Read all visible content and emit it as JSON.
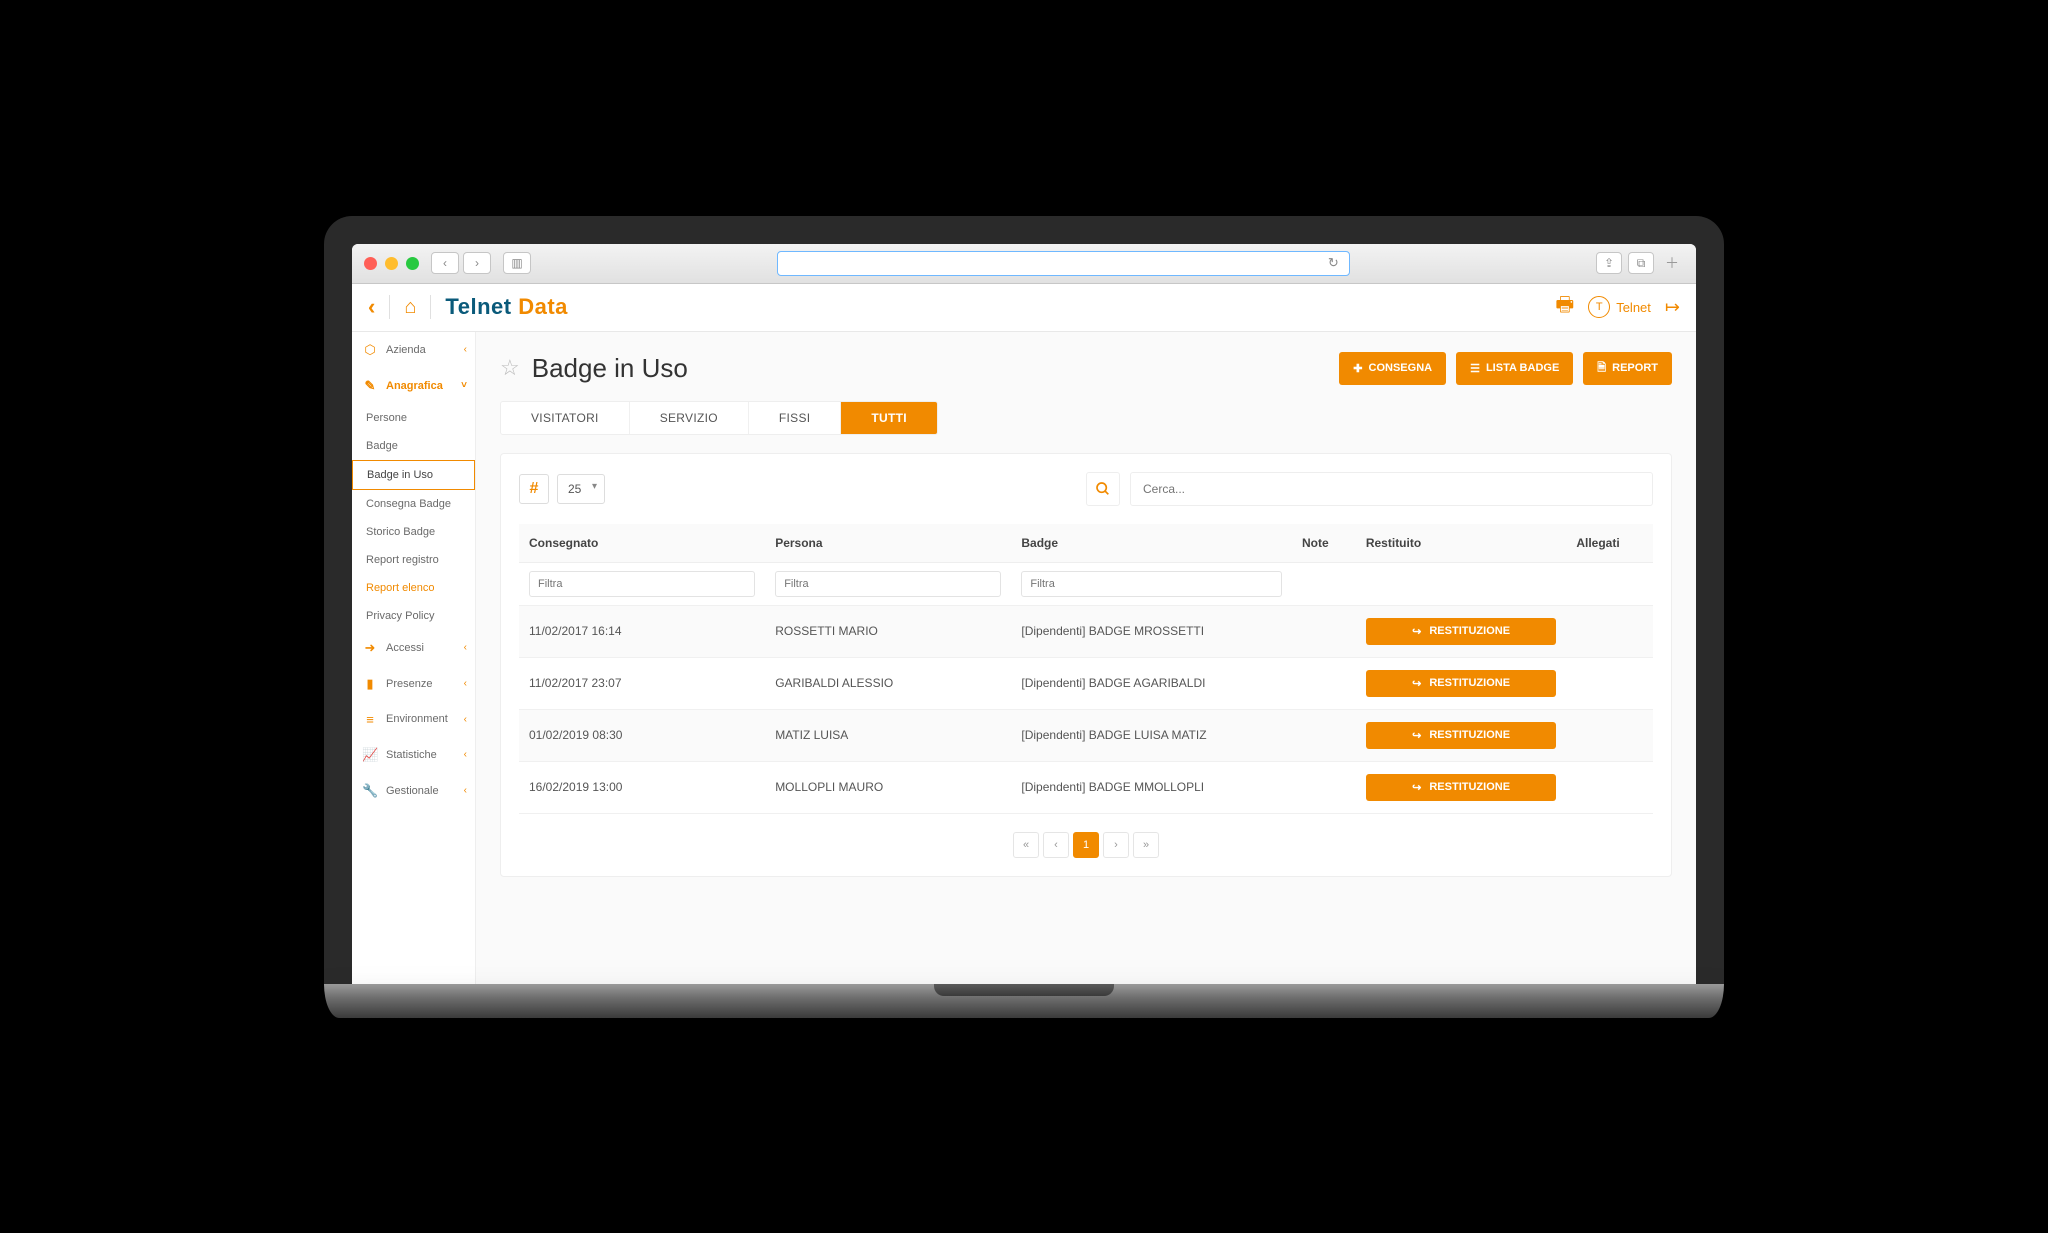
{
  "logo": {
    "part1": "Telnet",
    "part2": "Data"
  },
  "header": {
    "user_label": "Telnet",
    "user_initial": "T"
  },
  "sidebar": {
    "sections": [
      {
        "icon": "⬡",
        "label": "Azienda",
        "chev": "‹"
      },
      {
        "icon": "✎",
        "label": "Anagrafica",
        "chev": "˅",
        "active": true
      }
    ],
    "subs": [
      {
        "label": "Persone"
      },
      {
        "label": "Badge"
      },
      {
        "label": "Badge in Uso",
        "current": true
      },
      {
        "label": "Consegna Badge"
      },
      {
        "label": "Storico Badge"
      },
      {
        "label": "Report registro"
      },
      {
        "label": "Report elenco",
        "orange": true
      },
      {
        "label": "Privacy Policy"
      }
    ],
    "bottom": [
      {
        "icon": "➜",
        "label": "Accessi"
      },
      {
        "icon": "▮",
        "label": "Presenze"
      },
      {
        "icon": "≡",
        "label": "Environment"
      },
      {
        "icon": "📈",
        "label": "Statistiche"
      },
      {
        "icon": "🔧",
        "label": "Gestionale"
      }
    ]
  },
  "page": {
    "title": "Badge in Uso",
    "actions": [
      {
        "icon": "✚",
        "label": "CONSEGNA"
      },
      {
        "icon": "☰",
        "label": "LISTA BADGE"
      },
      {
        "icon": "🗎",
        "label": "REPORT"
      }
    ],
    "tabs": [
      "VISITATORI",
      "SERVIZIO",
      "FISSI",
      "TUTTI"
    ],
    "active_tab": 3
  },
  "table": {
    "per_page": "25",
    "search_placeholder": "Cerca...",
    "filter_placeholder": "Filtra",
    "restituzione_label": "RESTITUZIONE",
    "columns": [
      "Consegnato",
      "Persona",
      "Badge",
      "Note",
      "Restituito",
      "Allegati"
    ],
    "rows": [
      {
        "consegnato": "11/02/2017 16:14",
        "persona": "ROSSETTI MARIO",
        "badge": "[Dipendenti] BADGE MROSSETTI"
      },
      {
        "consegnato": "11/02/2017 23:07",
        "persona": "GARIBALDI ALESSIO",
        "badge": "[Dipendenti] BADGE AGARIBALDI"
      },
      {
        "consegnato": "01/02/2019 08:30",
        "persona": "MATIZ LUISA",
        "badge": "[Dipendenti] BADGE LUISA MATIZ"
      },
      {
        "consegnato": "16/02/2019 13:00",
        "persona": "MOLLOPLI MAURO",
        "badge": "[Dipendenti] BADGE MMOLLOPLI"
      }
    ],
    "pagination": {
      "current": "1"
    }
  }
}
